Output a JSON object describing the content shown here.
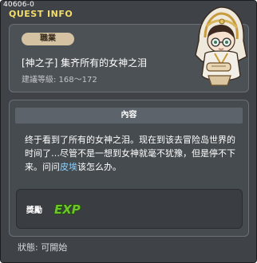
{
  "header": {
    "quest_id": "40606-0",
    "title": "QUEST INFO"
  },
  "quest": {
    "job_badge": "職業",
    "name": "[神之子] 集齐所有的女神之泪",
    "level_requirement": "建議等級: 168～172",
    "npc_portrait_icon": "goddess-npc-icon"
  },
  "content": {
    "header": "內容",
    "description_before": "终于看到了所有的女神之泪。现在到该去冒险岛世界的时间了…尽管不是一想到女神就毫不犹豫，但是停不下来。问问",
    "description_highlight": "皮埃",
    "description_after": "该怎么办。"
  },
  "reward": {
    "label": "獎勵",
    "exp_icon": "exp-icon",
    "exp_text": "EXP"
  },
  "status": {
    "text": "狀態: 可開始"
  },
  "colors": {
    "title": "#f3dd6a",
    "highlight": "#8fd3ff",
    "exp_green": "#6cc629"
  }
}
